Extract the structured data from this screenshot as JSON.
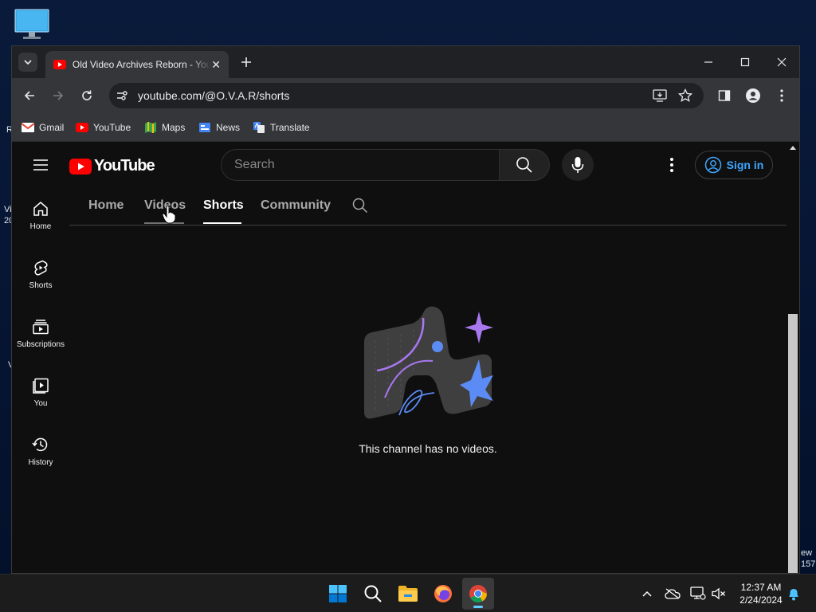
{
  "desktop": {
    "fragments": [
      "R",
      "Vi",
      "20",
      "V",
      "ew",
      "157"
    ]
  },
  "browser": {
    "tab_title": "Old Video Archives Reborn - YouTube",
    "tab_close": "✕",
    "new_tab": "+",
    "url": "youtube.com/@O.V.A.R/shorts",
    "bookmarks": [
      "Gmail",
      "YouTube",
      "Maps",
      "News",
      "Translate"
    ]
  },
  "youtube": {
    "logo_text": "YouTube",
    "search_placeholder": "Search",
    "signin_label": "Sign in",
    "guide": [
      {
        "label": "Home",
        "icon": "home-icon"
      },
      {
        "label": "Shorts",
        "icon": "shorts-icon"
      },
      {
        "label": "Subscriptions",
        "icon": "subscriptions-icon"
      },
      {
        "label": "You",
        "icon": "you-icon"
      },
      {
        "label": "History",
        "icon": "history-icon"
      }
    ],
    "channel_tabs": [
      "Home",
      "Videos",
      "Shorts",
      "Community"
    ],
    "active_tab": "Shorts",
    "empty_message": "This channel has no videos."
  },
  "taskbar": {
    "time": "12:37 AM",
    "date": "2/24/2024"
  },
  "colors": {
    "yt_red": "#ff0000",
    "link_blue": "#3ea6ff",
    "illus_purple": "#a878f0",
    "illus_blue": "#5b8cf5"
  }
}
